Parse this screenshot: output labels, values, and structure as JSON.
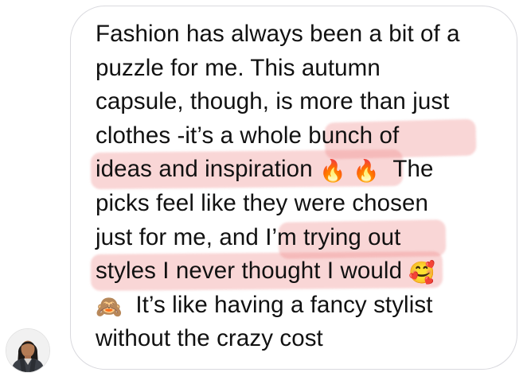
{
  "chat": {
    "message": {
      "line1": "Fashion has always been a bit of a",
      "line2": "puzzle for me. This autumn",
      "line3": "capsule, though, is more than just",
      "line4": "clothes -it’s a whole bunch of",
      "line5": "ideas and inspiration",
      "line5_tail": "The",
      "line6": "picks feel like they were chosen",
      "line7": "just for me, and I’m trying out",
      "line8": "styles I never thought I would",
      "line9": "It’s like having a fancy stylist",
      "line10": "without the crazy cost",
      "emoji_fire": "🔥",
      "emoji_smiling_hearts": "🥰",
      "emoji_see_no_evil": "🙈"
    },
    "highlight_color": "#ec8080",
    "bubble_border_color": "#d9d9de",
    "text_color": "#111111",
    "avatar_icon": "user-avatar"
  }
}
